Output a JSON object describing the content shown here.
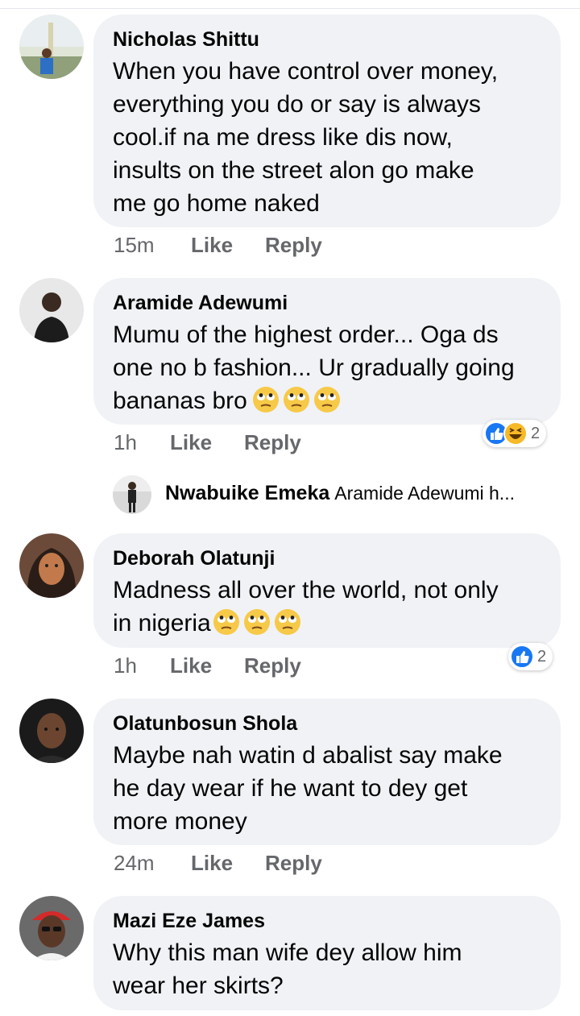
{
  "comments": [
    {
      "author": "Nicholas Shittu",
      "lines": [
        "When you have control over money,",
        "everything you do or say is always",
        "cool.if na me dress like dis now,",
        "insults on the street alon go make",
        "me go home naked"
      ],
      "time": "15m",
      "like_label": "Like",
      "reply_label": "Reply"
    },
    {
      "author": "Aramide Adewumi",
      "lines": [
        "Mumu of the highest order... Oga ds",
        "one no b fashion... Ur gradually going",
        "bananas bro"
      ],
      "emoji": "face-with-rolling-eyes",
      "time": "1h",
      "like_label": "Like",
      "reply_label": "Reply",
      "reactions": {
        "icons": [
          "like",
          "haha"
        ],
        "count": "2"
      }
    },
    {
      "author": "Deborah Olatunji",
      "lines": [
        "Madness all over the world, not only",
        "in nigeria"
      ],
      "emoji": "face-with-rolling-eyes",
      "time": "1h",
      "like_label": "Like",
      "reply_label": "Reply",
      "reactions": {
        "icons": [
          "like"
        ],
        "count": "2"
      }
    },
    {
      "author": "Olatunbosun Shola",
      "lines": [
        "Maybe nah watin d abalist say make",
        "he day wear if he want to dey get",
        "more money"
      ],
      "time": "24m",
      "like_label": "Like",
      "reply_label": "Reply"
    },
    {
      "author": "Mazi Eze James",
      "lines": [
        "Why this man wife dey allow him",
        "wear her skirts?"
      ]
    }
  ],
  "reply_preview": {
    "author": "Nwabuike Emeka",
    "text": "Aramide Adewumi h..."
  },
  "colors": {
    "bubble": "#f0f2f5",
    "meta": "#65676b",
    "like_blue": "#1877f2",
    "haha_yellow": "#f7b928"
  }
}
